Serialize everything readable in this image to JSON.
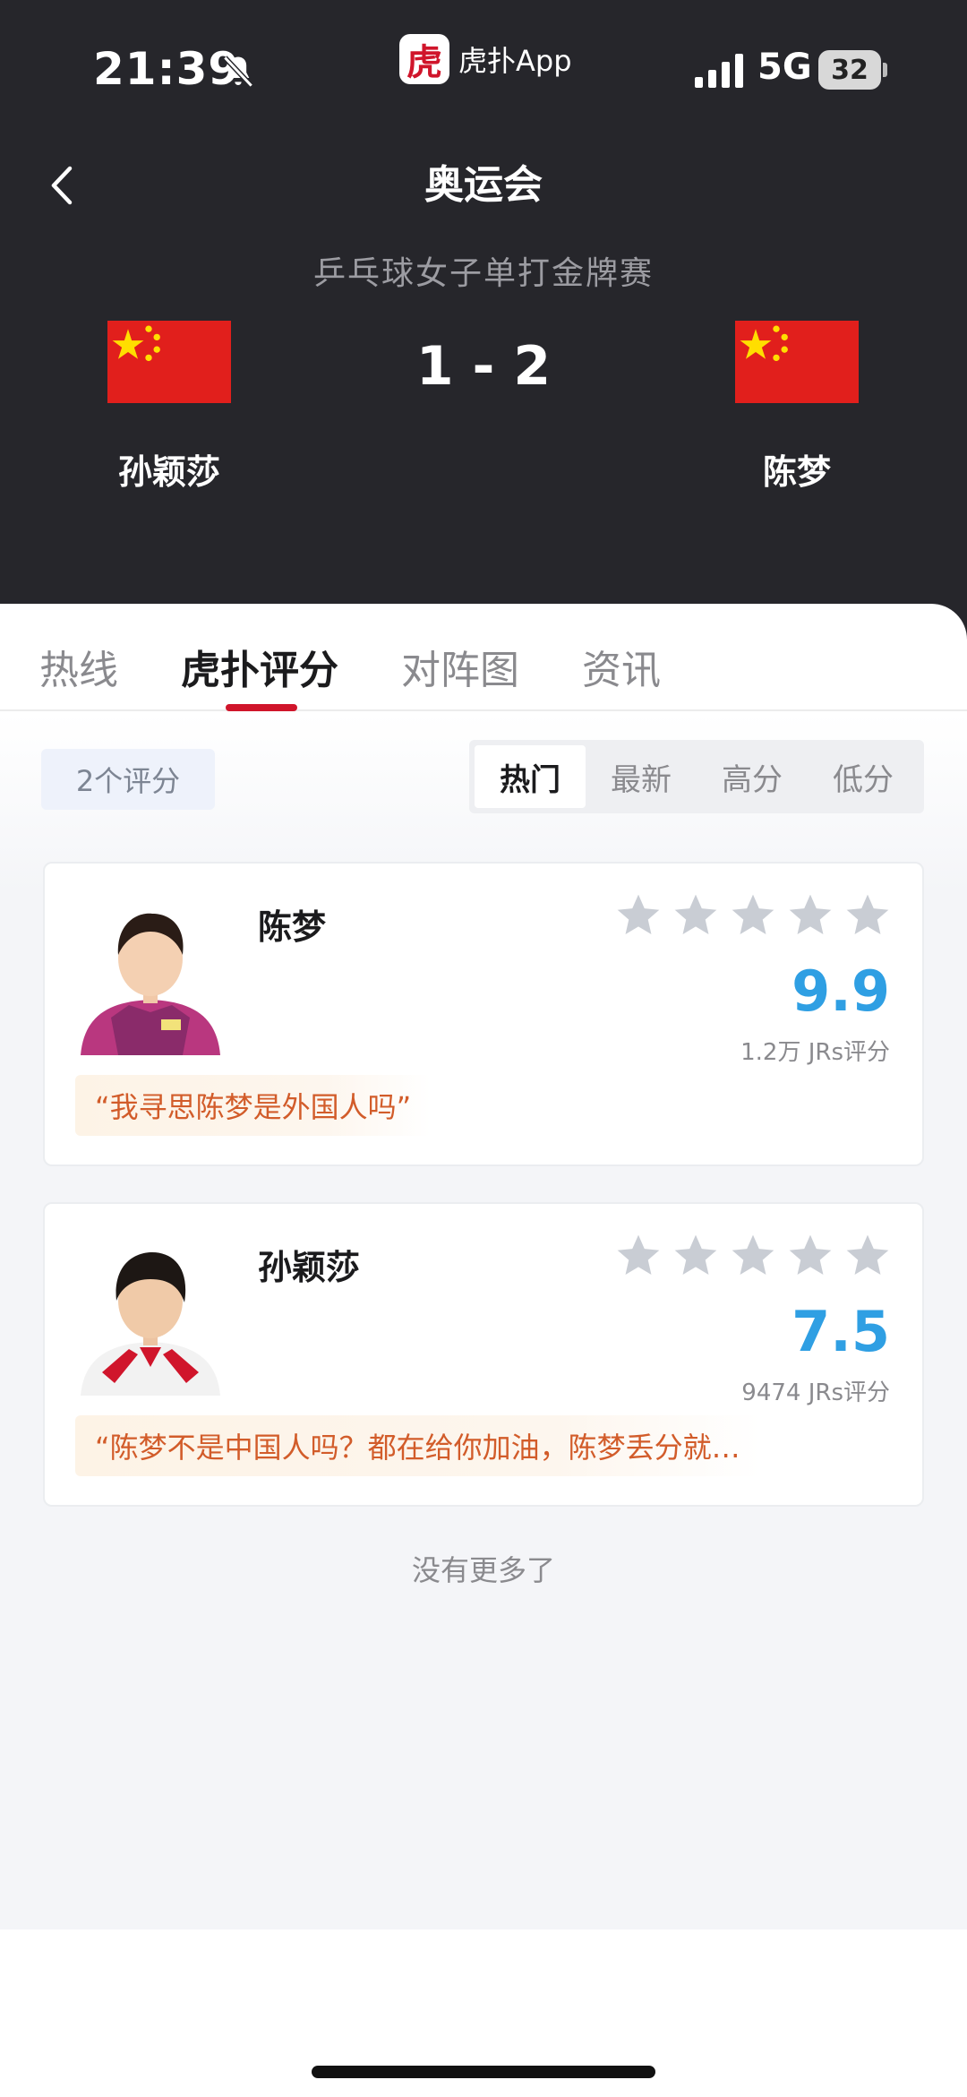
{
  "status_bar": {
    "time": "21:39",
    "network": "5G",
    "battery": "32"
  },
  "app": {
    "logo_char": "虎",
    "name": "虎扑App"
  },
  "header": {
    "title": "奥运会",
    "subtitle": "乒乓球女子单打金牌赛",
    "score": "1 - 2",
    "left_player": "孙颖莎",
    "right_player": "陈梦"
  },
  "tabs": [
    {
      "label": "热线"
    },
    {
      "label": "虎扑评分"
    },
    {
      "label": "对阵图"
    },
    {
      "label": "资讯"
    }
  ],
  "rating_count": "2个评分",
  "sort_options": [
    {
      "label": "热门"
    },
    {
      "label": "最新"
    },
    {
      "label": "高分"
    },
    {
      "label": "低分"
    }
  ],
  "ratings": [
    {
      "name": "陈梦",
      "score": "9.9",
      "votes": "1.2万 JRs评分",
      "quote": "“我寻思陈梦是外国人吗”",
      "stars": 5
    },
    {
      "name": "孙颖莎",
      "score": "7.5",
      "votes": "9474 JRs评分",
      "quote": "“陈梦不是中国人吗？都在给你加油，陈梦丢分就…",
      "stars": 5
    }
  ],
  "footer": {
    "no_more": "没有更多了"
  },
  "colors": {
    "header_bg": "#26262b",
    "accent_red": "#d0152b",
    "rating_blue": "#2f9fe3",
    "quote_orange": "#d25c2a",
    "star_gray": "#c9cdd4"
  },
  "icons": {
    "back": "chevron-left-icon",
    "bell": "bell-slash-icon",
    "signal": "signal-bars-icon",
    "star": "star-icon"
  }
}
